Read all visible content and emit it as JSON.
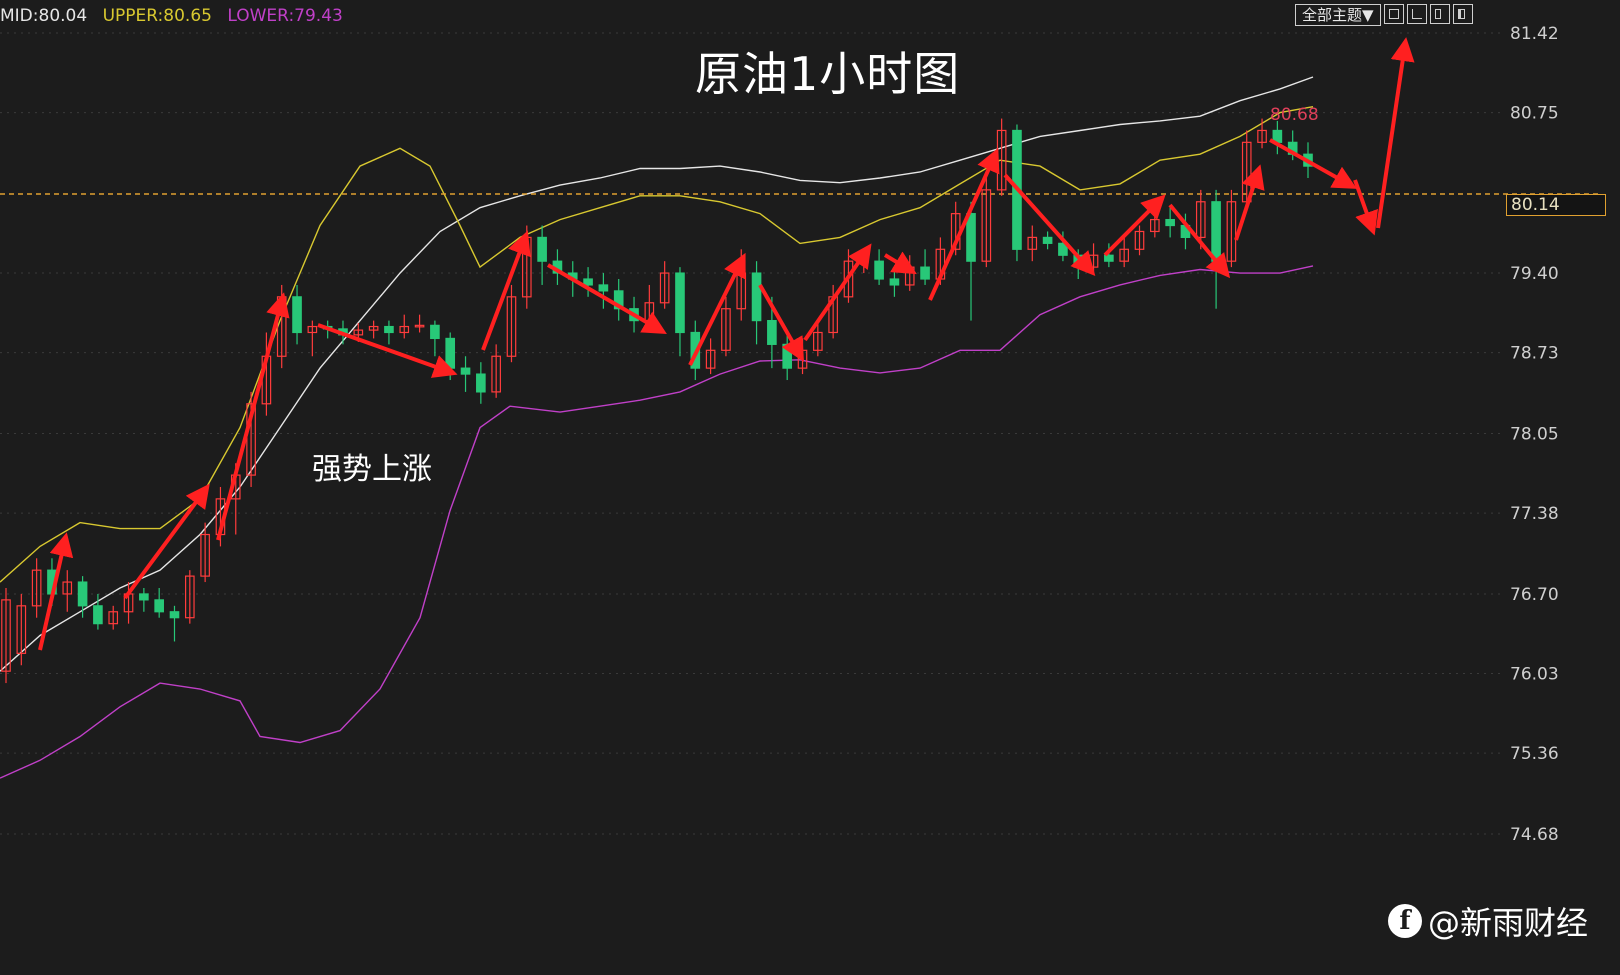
{
  "legend": {
    "mid": {
      "label": "MID:80.04",
      "color": "#e6e6e6"
    },
    "upper": {
      "label": "UPPER:80.65",
      "color": "#d8c830"
    },
    "lower": {
      "label": "LOWER:79.43",
      "color": "#c040c8"
    }
  },
  "title": "原油1小时图",
  "annotation": "强势上涨",
  "toolbar": {
    "theme_label": "全部主题▼"
  },
  "current_price": "80.14",
  "max_label": "80.68",
  "watermark": "@新雨财经",
  "colors": {
    "background": "#1c1c1c",
    "up_candle": "#ff3c3c",
    "down_candle": "#28c878",
    "mid_line": "#e6e6e6",
    "upper_band": "#d8c830",
    "lower_band": "#c040c8",
    "arrow": "#ff2020",
    "price_line": "#e0a030"
  },
  "chart_data": {
    "type": "candlestick",
    "title": "原油1小时图",
    "y_ticks": [
      "81.42",
      "80.75",
      "79.40",
      "78.73",
      "78.05",
      "77.38",
      "76.70",
      "76.03",
      "75.36",
      "74.68"
    ],
    "ylim": [
      74.1,
      81.7
    ],
    "series": [
      {
        "name": "MID",
        "points": [
          [
            0,
            76.05
          ],
          [
            40,
            76.35
          ],
          [
            80,
            76.55
          ],
          [
            120,
            76.75
          ],
          [
            160,
            76.9
          ],
          [
            200,
            77.2
          ],
          [
            240,
            77.6
          ],
          [
            280,
            78.1
          ],
          [
            320,
            78.6
          ],
          [
            360,
            79.0
          ],
          [
            400,
            79.4
          ],
          [
            440,
            79.75
          ],
          [
            480,
            79.95
          ],
          [
            520,
            80.05
          ],
          [
            560,
            80.14
          ],
          [
            600,
            80.2
          ],
          [
            640,
            80.28
          ],
          [
            680,
            80.28
          ],
          [
            720,
            80.3
          ],
          [
            760,
            80.25
          ],
          [
            800,
            80.18
          ],
          [
            840,
            80.16
          ],
          [
            880,
            80.2
          ],
          [
            920,
            80.25
          ],
          [
            960,
            80.35
          ],
          [
            1000,
            80.45
          ],
          [
            1040,
            80.55
          ],
          [
            1080,
            80.6
          ],
          [
            1120,
            80.65
          ],
          [
            1160,
            80.68
          ],
          [
            1200,
            80.72
          ],
          [
            1240,
            80.85
          ],
          [
            1280,
            80.95
          ],
          [
            1313,
            81.05
          ]
        ]
      },
      {
        "name": "UPPER",
        "points": [
          [
            0,
            76.8
          ],
          [
            40,
            77.1
          ],
          [
            80,
            77.3
          ],
          [
            120,
            77.25
          ],
          [
            160,
            77.25
          ],
          [
            200,
            77.5
          ],
          [
            240,
            78.1
          ],
          [
            280,
            79.0
          ],
          [
            320,
            79.8
          ],
          [
            360,
            80.3
          ],
          [
            400,
            80.45
          ],
          [
            430,
            80.3
          ],
          [
            460,
            79.8
          ],
          [
            480,
            79.45
          ],
          [
            520,
            79.7
          ],
          [
            560,
            79.85
          ],
          [
            600,
            79.95
          ],
          [
            640,
            80.05
          ],
          [
            680,
            80.05
          ],
          [
            720,
            80.0
          ],
          [
            760,
            79.9
          ],
          [
            800,
            79.65
          ],
          [
            840,
            79.7
          ],
          [
            880,
            79.85
          ],
          [
            920,
            79.95
          ],
          [
            960,
            80.15
          ],
          [
            1000,
            80.35
          ],
          [
            1040,
            80.3
          ],
          [
            1080,
            80.1
          ],
          [
            1120,
            80.15
          ],
          [
            1160,
            80.35
          ],
          [
            1200,
            80.4
          ],
          [
            1240,
            80.55
          ],
          [
            1280,
            80.75
          ],
          [
            1313,
            80.8
          ]
        ]
      },
      {
        "name": "LOWER",
        "points": [
          [
            0,
            75.15
          ],
          [
            40,
            75.3
          ],
          [
            80,
            75.5
          ],
          [
            120,
            75.75
          ],
          [
            160,
            75.95
          ],
          [
            200,
            75.9
          ],
          [
            240,
            75.8
          ],
          [
            260,
            75.5
          ],
          [
            300,
            75.45
          ],
          [
            340,
            75.55
          ],
          [
            380,
            75.9
          ],
          [
            420,
            76.5
          ],
          [
            450,
            77.4
          ],
          [
            480,
            78.1
          ],
          [
            510,
            78.28
          ],
          [
            560,
            78.23
          ],
          [
            600,
            78.28
          ],
          [
            640,
            78.33
          ],
          [
            680,
            78.4
          ],
          [
            720,
            78.55
          ],
          [
            760,
            78.66
          ],
          [
            800,
            78.67
          ],
          [
            840,
            78.6
          ],
          [
            880,
            78.56
          ],
          [
            920,
            78.6
          ],
          [
            960,
            78.75
          ],
          [
            1000,
            78.75
          ],
          [
            1040,
            79.05
          ],
          [
            1080,
            79.2
          ],
          [
            1120,
            79.3
          ],
          [
            1160,
            79.38
          ],
          [
            1200,
            79.43
          ],
          [
            1240,
            79.4
          ],
          [
            1280,
            79.4
          ],
          [
            1313,
            79.46
          ]
        ]
      }
    ],
    "candles": [
      [
        76.05,
        76.65,
        75.95,
        76.75
      ],
      [
        76.2,
        76.6,
        76.1,
        76.7
      ],
      [
        76.6,
        76.9,
        76.5,
        77.0
      ],
      [
        76.9,
        76.7,
        76.6,
        77.0
      ],
      [
        76.7,
        76.8,
        76.55,
        76.9
      ],
      [
        76.8,
        76.6,
        76.5,
        76.85
      ],
      [
        76.6,
        76.45,
        76.4,
        76.7
      ],
      [
        76.45,
        76.55,
        76.4,
        76.6
      ],
      [
        76.55,
        76.7,
        76.45,
        76.8
      ],
      [
        76.7,
        76.65,
        76.55,
        76.75
      ],
      [
        76.65,
        76.55,
        76.5,
        76.75
      ],
      [
        76.55,
        76.5,
        76.3,
        76.6
      ],
      [
        76.5,
        76.85,
        76.45,
        76.9
      ],
      [
        76.85,
        77.2,
        76.8,
        77.3
      ],
      [
        77.2,
        77.5,
        77.1,
        77.6
      ],
      [
        77.5,
        77.7,
        77.2,
        77.8
      ],
      [
        77.7,
        78.3,
        77.6,
        78.4
      ],
      [
        78.3,
        78.7,
        78.2,
        78.9
      ],
      [
        78.7,
        79.2,
        78.6,
        79.3
      ],
      [
        79.2,
        78.9,
        78.8,
        79.3
      ],
      [
        78.9,
        78.95,
        78.7,
        79.0
      ],
      [
        78.95,
        78.93,
        78.85,
        79.0
      ],
      [
        78.93,
        78.88,
        78.8,
        79.0
      ],
      [
        78.88,
        78.92,
        78.82,
        78.98
      ],
      [
        78.92,
        78.95,
        78.85,
        79.0
      ],
      [
        78.95,
        78.9,
        78.8,
        79.0
      ],
      [
        78.9,
        78.95,
        78.85,
        79.05
      ],
      [
        78.95,
        78.96,
        78.9,
        79.05
      ],
      [
        78.96,
        78.85,
        78.7,
        79.0
      ],
      [
        78.85,
        78.6,
        78.5,
        78.9
      ],
      [
        78.6,
        78.55,
        78.4,
        78.7
      ],
      [
        78.55,
        78.4,
        78.3,
        78.65
      ],
      [
        78.4,
        78.7,
        78.35,
        78.8
      ],
      [
        78.7,
        79.2,
        78.65,
        79.3
      ],
      [
        79.2,
        79.7,
        79.1,
        79.8
      ],
      [
        79.7,
        79.5,
        79.3,
        79.8
      ],
      [
        79.5,
        79.4,
        79.3,
        79.6
      ],
      [
        79.4,
        79.35,
        79.2,
        79.5
      ],
      [
        79.35,
        79.3,
        79.2,
        79.45
      ],
      [
        79.3,
        79.25,
        79.1,
        79.4
      ],
      [
        79.25,
        79.1,
        79.0,
        79.35
      ],
      [
        79.1,
        79.0,
        78.9,
        79.2
      ],
      [
        79.0,
        79.15,
        78.95,
        79.3
      ],
      [
        79.15,
        79.4,
        79.1,
        79.5
      ],
      [
        79.4,
        78.9,
        78.7,
        79.45
      ],
      [
        78.9,
        78.6,
        78.5,
        79.0
      ],
      [
        78.6,
        78.75,
        78.55,
        78.85
      ],
      [
        78.75,
        79.1,
        78.7,
        79.2
      ],
      [
        79.1,
        79.4,
        79.0,
        79.6
      ],
      [
        79.4,
        79.0,
        78.8,
        79.5
      ],
      [
        79.0,
        78.8,
        78.6,
        79.2
      ],
      [
        78.8,
        78.6,
        78.5,
        78.9
      ],
      [
        78.6,
        78.75,
        78.55,
        78.85
      ],
      [
        78.75,
        78.9,
        78.7,
        79.0
      ],
      [
        78.9,
        79.2,
        78.85,
        79.3
      ],
      [
        79.2,
        79.5,
        79.15,
        79.6
      ],
      [
        79.5,
        79.5,
        79.4,
        79.6
      ],
      [
        79.5,
        79.35,
        79.3,
        79.6
      ],
      [
        79.35,
        79.3,
        79.2,
        79.45
      ],
      [
        79.3,
        79.45,
        79.25,
        79.55
      ],
      [
        79.45,
        79.35,
        79.3,
        79.6
      ],
      [
        79.35,
        79.6,
        79.3,
        79.7
      ],
      [
        79.6,
        79.9,
        79.55,
        80.0
      ],
      [
        79.9,
        79.5,
        79.0,
        80.0
      ],
      [
        79.5,
        80.1,
        79.45,
        80.2
      ],
      [
        80.1,
        80.6,
        80.05,
        80.7
      ],
      [
        80.6,
        79.6,
        79.5,
        80.65
      ],
      [
        79.6,
        79.7,
        79.5,
        79.8
      ],
      [
        79.7,
        79.65,
        79.6,
        79.75
      ],
      [
        79.65,
        79.55,
        79.5,
        79.75
      ],
      [
        79.55,
        79.45,
        79.35,
        79.6
      ],
      [
        79.45,
        79.55,
        79.4,
        79.65
      ],
      [
        79.55,
        79.5,
        79.45,
        79.65
      ],
      [
        79.5,
        79.6,
        79.45,
        79.7
      ],
      [
        79.6,
        79.75,
        79.55,
        79.8
      ],
      [
        79.75,
        79.85,
        79.7,
        79.95
      ],
      [
        79.85,
        79.8,
        79.7,
        79.95
      ],
      [
        79.8,
        79.7,
        79.6,
        79.9
      ],
      [
        79.7,
        80.0,
        79.6,
        80.1
      ],
      [
        80.0,
        79.5,
        79.1,
        80.1
      ],
      [
        79.5,
        80.0,
        79.45,
        80.1
      ],
      [
        80.0,
        80.5,
        79.95,
        80.6
      ],
      [
        80.5,
        80.6,
        80.45,
        80.7
      ],
      [
        80.6,
        80.5,
        80.4,
        80.68
      ],
      [
        80.5,
        80.4,
        80.35,
        80.6
      ],
      [
        80.4,
        80.3,
        80.2,
        80.5
      ]
    ],
    "xlabel": "",
    "ylabel": ""
  }
}
